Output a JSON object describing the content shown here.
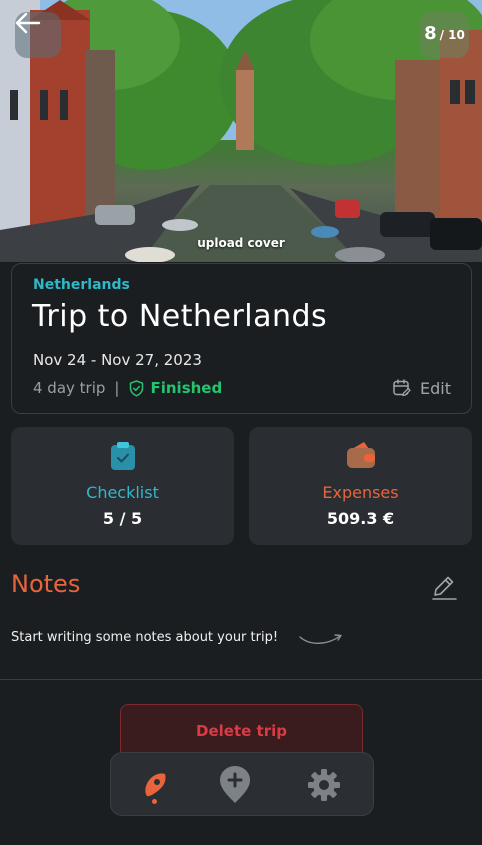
{
  "cover": {
    "upload_label": "upload cover",
    "rating_value": "8",
    "rating_max": "/ 10"
  },
  "trip": {
    "country": "Netherlands",
    "title": "Trip to Netherlands",
    "dates": "Nov 24 - Nov 27, 2023",
    "length": "4 day trip",
    "separator": "|",
    "status": "Finished",
    "edit_label": "Edit"
  },
  "checklist": {
    "label": "Checklist",
    "value": "5 / 5",
    "color": "#2fb8c8"
  },
  "expenses": {
    "label": "Expenses",
    "value": "509.3 €",
    "color": "#e8643a"
  },
  "notes": {
    "title": "Notes",
    "placeholder": "Start writing some notes about your trip!"
  },
  "actions": {
    "delete_label": "Delete trip"
  },
  "nav": {
    "items": [
      {
        "icon": "rocket-icon",
        "active": true
      },
      {
        "icon": "add-location-icon",
        "active": false
      },
      {
        "icon": "gear-icon",
        "active": false
      }
    ]
  },
  "colors": {
    "accent_orange": "#e8643a",
    "accent_teal": "#2fb8c8",
    "success_green": "#25c46d",
    "danger_red": "#d93c45",
    "background": "#1b1e21",
    "tile": "#2a2e33"
  }
}
